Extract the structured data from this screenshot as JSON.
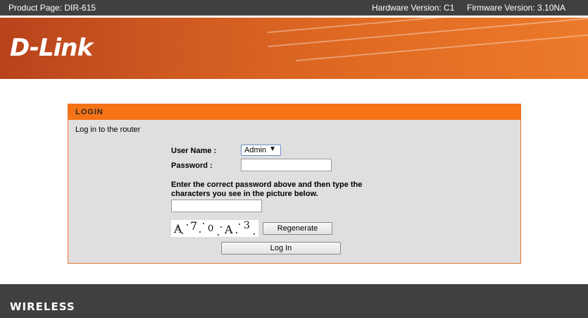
{
  "topbar": {
    "product": "Product Page: DIR-615",
    "hardware": "Hardware Version: C1",
    "firmware": "Firmware Version: 3.10NA"
  },
  "banner": {
    "logo_text": "D-Link"
  },
  "login": {
    "header": "LOGIN",
    "subtitle": "Log in to the router",
    "username_label": "User Name :",
    "username_value": "Admin",
    "password_label": "Password :",
    "password_value": "",
    "captcha_instructions_line1": "Enter the correct password above and then type the",
    "captcha_instructions_line2": "characters you see in the picture below.",
    "captcha_value": "",
    "captcha_chars": [
      "A",
      "7",
      "0",
      "A",
      "3"
    ],
    "regenerate_label": "Regenerate",
    "login_label": "Log In"
  },
  "footer": {
    "brand": "WIRELESS"
  },
  "colors": {
    "topbar": "#404040",
    "banner_orange": "#e06a22",
    "panel_header": "#f57315",
    "panel_bg": "#dfdfdf",
    "footer": "#404040"
  }
}
